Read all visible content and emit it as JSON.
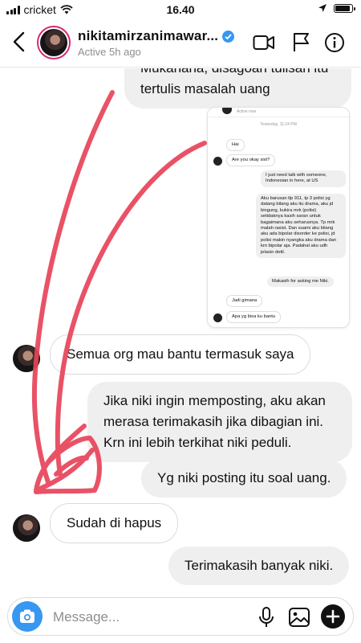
{
  "status_bar": {
    "carrier": "cricket",
    "time": "16.40",
    "battery_level": 0.9
  },
  "header": {
    "username": "nikitamirzanimawar...",
    "status": "Active 5h ago",
    "icons": [
      "back-chevron",
      "verified-badge",
      "video-call",
      "flag",
      "info"
    ]
  },
  "messages": {
    "m1_line1": "Mukanana, disagoan tulisan itu",
    "m1_line2": "tertulis masalah uang",
    "m2": "Semua org mau bantu termasuk saya",
    "m3_line1": "Jika niki ingin memposting, aku akan",
    "m3_line2": "merasa terimakasih jika dibagian ini.",
    "m3_line3": "Krn ini lebih terkihat niki peduli.",
    "m4": "Yg niki posting itu soal uang.",
    "m5": "Sudah di hapus",
    "m6": "Terimakasih banyak niki."
  },
  "screenshot": {
    "active": "Active now",
    "date": "Yesterday, 11:24 PM",
    "s1": "Hai",
    "s2": "Are you okay sist?",
    "s3_l1": "I just need talk with someone,",
    "s3_l2": "Indonesian in here, at US",
    "s4_lines": [
      "Aku barusan tlp 911, tp 3 polisi yg",
      "datang bilang aku itu drama, aku jd",
      "bingung, kukira mrk (polisi)",
      "setidaknya kasih saran untuk",
      "bagaimana aku seharusnya. Tp mrk",
      "malah rasist. Dan suami aku bilang",
      "aku ada bipolar disorder ke polisi, jd",
      "polisi makin nyangka aku drama dan",
      "krn bipolar aja. Padahal aku udh",
      "jelasin detil."
    ],
    "s5": "Makasih for asking me Niki.",
    "s6": "Jadi gimana",
    "s7": "Apa yg bisa ku bantu"
  },
  "composer": {
    "placeholder": "Message..."
  },
  "colors": {
    "accent": "#3897f0",
    "annotation": "#e8445a",
    "bubble_out": "#efefef"
  }
}
